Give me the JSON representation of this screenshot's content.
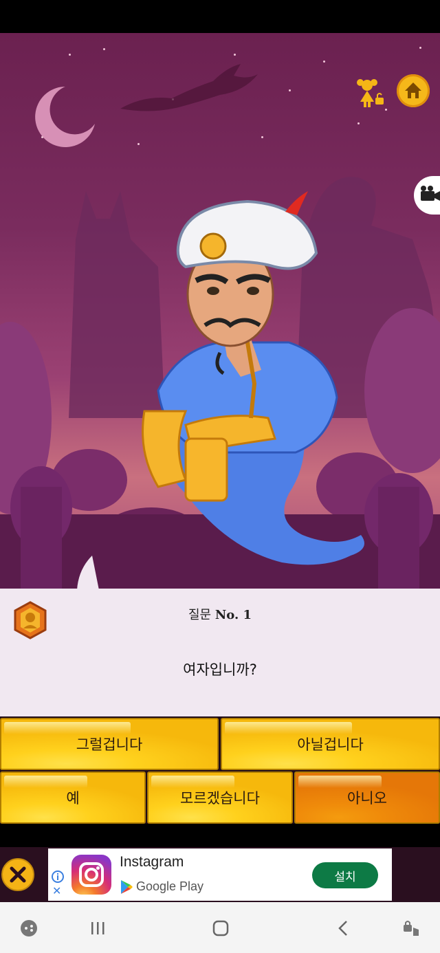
{
  "question": {
    "number_prefix": "질문",
    "number": "No. 1",
    "text": "여자입니까?"
  },
  "answers": [
    {
      "label": "그럴겁니다"
    },
    {
      "label": "아닐겁니다"
    },
    {
      "label": "예"
    },
    {
      "label": "모르겠습니다"
    },
    {
      "label": "아니오"
    }
  ],
  "ad": {
    "app_name": "Instagram",
    "store": "Google Play",
    "install_label": "설치"
  },
  "icons": {
    "top_right": [
      "girl-lock-icon",
      "home-icon"
    ],
    "side": "video-camera-icon",
    "navbar": [
      "game-tools-icon",
      "recent-apps-icon",
      "home-nav-icon",
      "back-icon",
      "touch-lock-icon"
    ]
  },
  "colors": {
    "button_yellow": "#ffd11d",
    "button_orange": "#ef8a0a",
    "scene_purple": "#6b2150",
    "install_green": "#0d7a45"
  }
}
